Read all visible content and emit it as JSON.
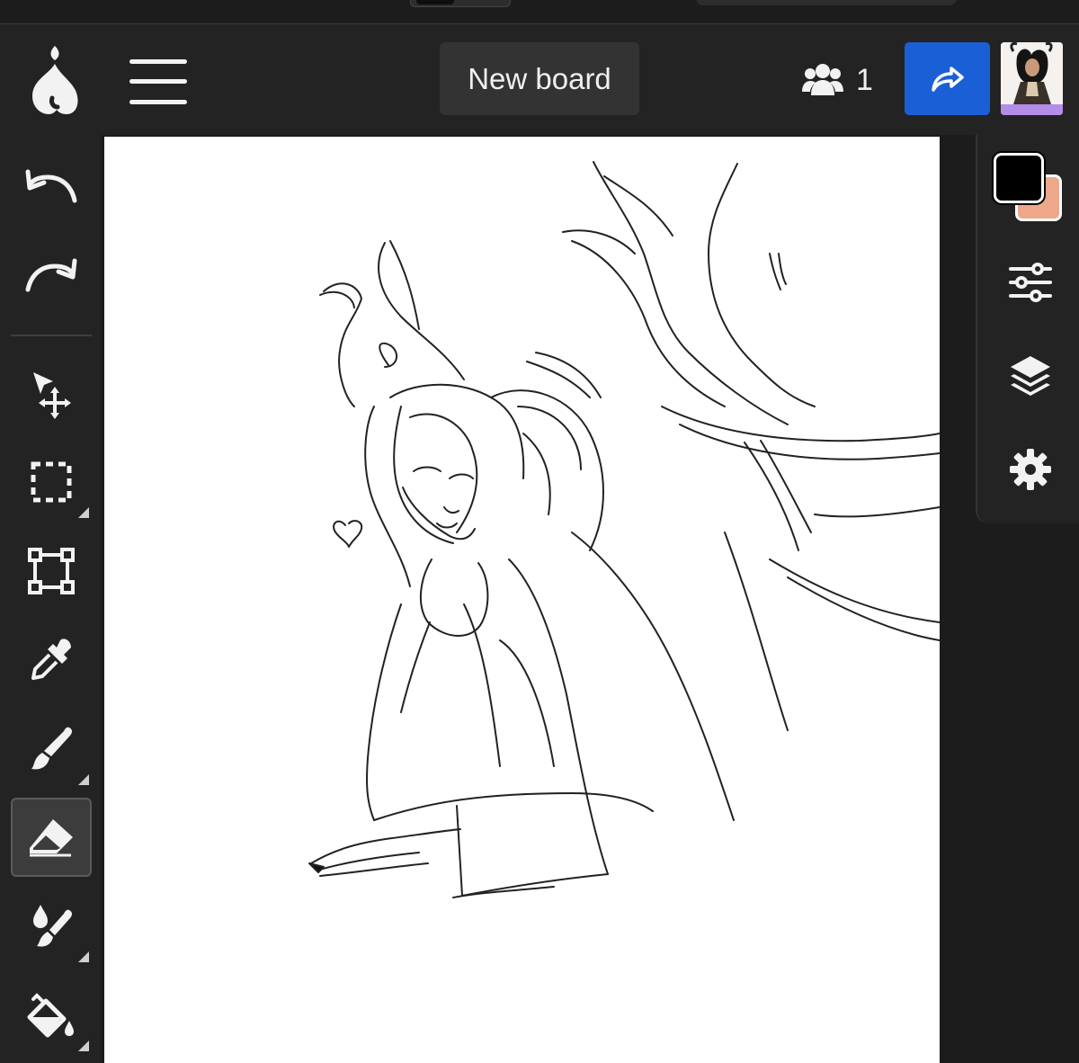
{
  "app": {
    "new_board_label": "New board",
    "user_count": "1"
  },
  "colors": {
    "primary": "#000000",
    "secondary": "#eda889",
    "share_button": "#1b5fd6",
    "avatar_accent": "#b58ce8"
  },
  "left_tools": [
    {
      "name": "undo",
      "icon": "undo-icon"
    },
    {
      "name": "redo",
      "icon": "redo-icon"
    },
    {
      "name": "move",
      "icon": "move-icon"
    },
    {
      "name": "select",
      "icon": "rect-select-icon"
    },
    {
      "name": "transform",
      "icon": "transform-icon"
    },
    {
      "name": "eyedropper",
      "icon": "eyedropper-icon"
    },
    {
      "name": "brush",
      "icon": "brush-icon"
    },
    {
      "name": "eraser",
      "icon": "eraser-icon",
      "active": true
    },
    {
      "name": "blend",
      "icon": "blend-icon"
    },
    {
      "name": "fill",
      "icon": "paint-bucket-icon"
    }
  ],
  "right_tools": [
    "adjustments-icon",
    "layers-icon",
    "settings-icon"
  ]
}
